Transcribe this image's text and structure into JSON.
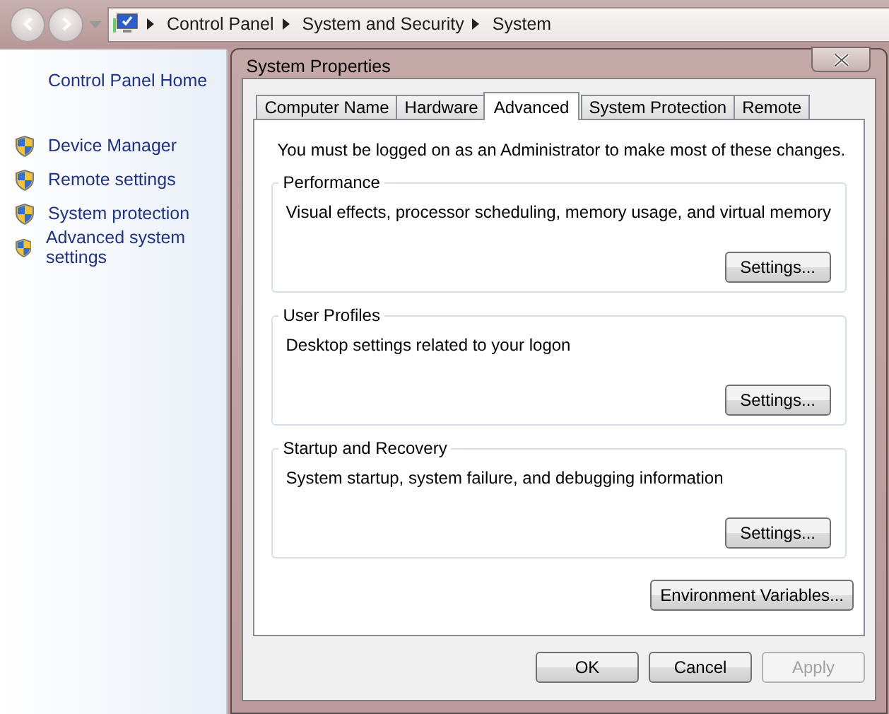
{
  "address_bar": {
    "crumbs": [
      "Control Panel",
      "System and Security",
      "System"
    ]
  },
  "sidebar": {
    "home": "Control Panel Home",
    "items": [
      {
        "label": "Device Manager"
      },
      {
        "label": "Remote settings"
      },
      {
        "label": "System protection"
      },
      {
        "label": "Advanced system settings"
      }
    ]
  },
  "dialog": {
    "title": "System Properties",
    "tabs": [
      {
        "label": "Computer Name",
        "selected": false
      },
      {
        "label": "Hardware",
        "selected": false
      },
      {
        "label": "Advanced",
        "selected": true
      },
      {
        "label": "System Protection",
        "selected": false
      },
      {
        "label": "Remote",
        "selected": false
      }
    ],
    "notice": "You must be logged on as an Administrator to make most of these changes.",
    "groups": [
      {
        "title": "Performance",
        "description": "Visual effects, processor scheduling, memory usage, and virtual memory",
        "button": "Settings..."
      },
      {
        "title": "User Profiles",
        "description": "Desktop settings related to your logon",
        "button": "Settings..."
      },
      {
        "title": "Startup and Recovery",
        "description": "System startup, system failure, and debugging information",
        "button": "Settings..."
      }
    ],
    "env_button": "Environment Variables...",
    "buttons": [
      {
        "label": "OK",
        "disabled": false
      },
      {
        "label": "Cancel",
        "disabled": false
      },
      {
        "label": "Apply",
        "disabled": true
      }
    ]
  }
}
